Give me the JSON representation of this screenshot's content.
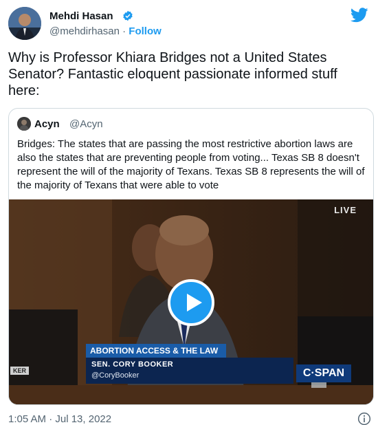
{
  "author": {
    "name": "Mehdi Hasan",
    "handle": "@mehdirhasan",
    "separator": "·",
    "follow_label": "Follow"
  },
  "tweet": {
    "text": "Why is Professor Khiara Bridges not a United States Senator? Fantastic eloquent passionate informed stuff here:",
    "timestamp": "1:05 AM · Jul 13, 2022"
  },
  "quote": {
    "name": "Acyn",
    "handle": "@Acyn",
    "text": "Bridges: The states that are passing the most restrictive abortion laws are also the states that are preventing people from voting... Texas SB 8 doesn't represent the will of the majority of Texans. Texas SB 8 represents the will of the majority of Texans that were able to vote"
  },
  "video": {
    "live_label": "LIVE",
    "lower_third_title": "ABORTION ACCESS & THE LAW",
    "lower_third_name": "SEN. CORY BOOKER",
    "lower_third_handle": "@CoryBooker",
    "network": "C·SPAN",
    "side_tag": "KER"
  },
  "colors": {
    "accent": "#1d9bf0",
    "text_primary": "#0f1419",
    "text_secondary": "#536471",
    "border": "#cfd9de"
  },
  "icons": [
    "verified-badge-icon",
    "twitter-bird-icon",
    "play-icon",
    "info-icon"
  ]
}
